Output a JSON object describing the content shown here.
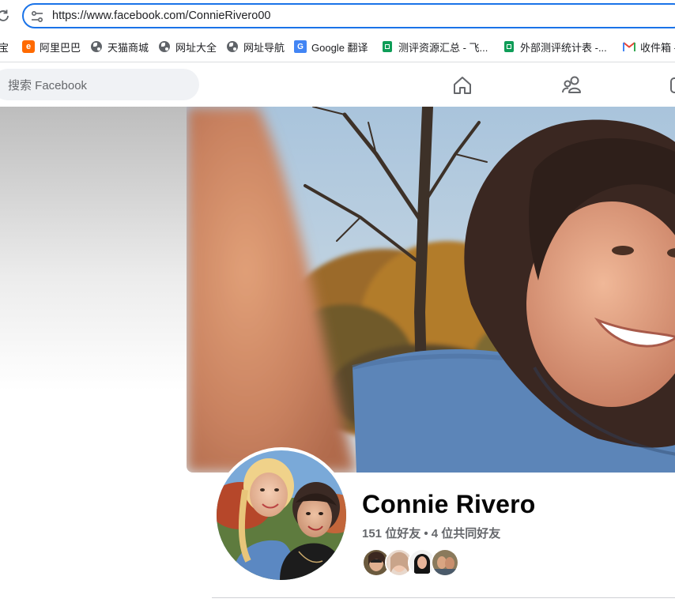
{
  "browser": {
    "url": "https://www.facebook.com/ConnieRivero00",
    "bookmarks": [
      {
        "label": "宝",
        "icon": "taobao-icon"
      },
      {
        "label": "阿里巴巴",
        "icon": "alibaba-icon"
      },
      {
        "label": "天猫商城",
        "icon": "globe-icon"
      },
      {
        "label": "网址大全",
        "icon": "globe-icon"
      },
      {
        "label": "网址导航",
        "icon": "globe-icon"
      },
      {
        "label": "Google 翻译",
        "icon": "google-translate-icon"
      },
      {
        "label": "测评资源汇总 - 飞...",
        "icon": "sheets-icon"
      },
      {
        "label": "外部测评统计表 -...",
        "icon": "sheets-icon"
      },
      {
        "label": "收件箱 -",
        "icon": "gmail-icon"
      }
    ]
  },
  "facebook": {
    "search_placeholder": "搜索 Facebook",
    "nav": [
      "home-icon",
      "friends-icon",
      "watch-icon"
    ]
  },
  "profile": {
    "name": "Connie Rivero",
    "friends_summary": "151 位好友 • 4 位共同好友",
    "mutual_friend_avatars": 4
  },
  "colors": {
    "accent": "#1a73e8",
    "fb_text": "#050505",
    "fb_secondary": "#65676b",
    "search_bg": "#f0f2f5"
  }
}
